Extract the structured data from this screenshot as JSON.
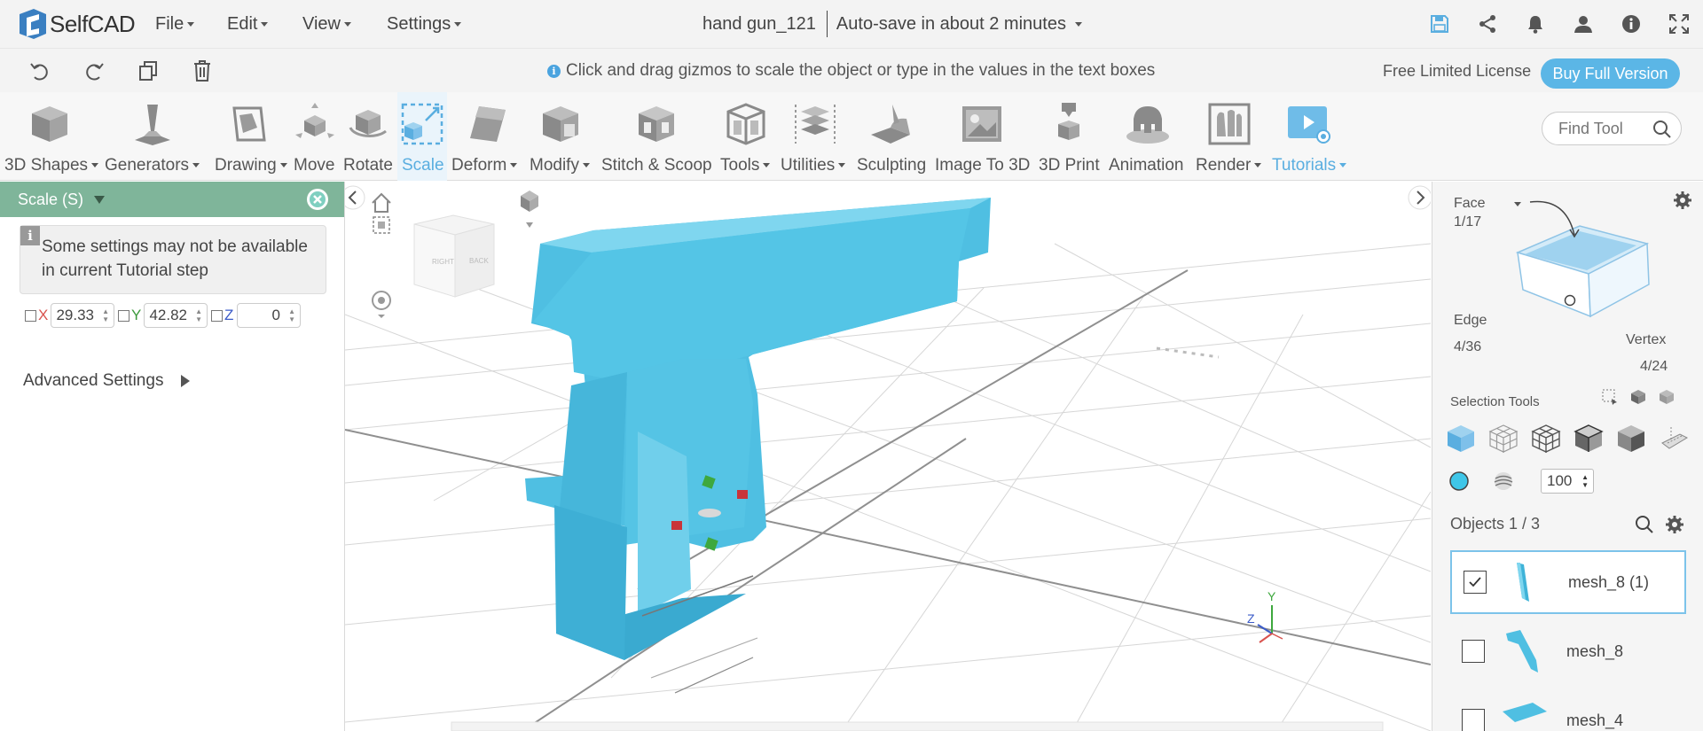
{
  "app": {
    "name": "SelfCAD"
  },
  "menu": [
    {
      "label": "File"
    },
    {
      "label": "Edit"
    },
    {
      "label": "View"
    },
    {
      "label": "Settings"
    }
  ],
  "document": {
    "title": "hand gun_121",
    "autosave": "Auto-save in about 2 minutes"
  },
  "hint": {
    "text": "Click and drag gizmos to scale the object or type in the values in the text boxes"
  },
  "license": {
    "text": "Free Limited License",
    "buy_label": "Buy Full Version"
  },
  "toolbar": {
    "tools": [
      {
        "label": "3D Shapes",
        "dropdown": true
      },
      {
        "label": "Generators",
        "dropdown": true
      },
      {
        "label": "Drawing",
        "dropdown": true
      },
      {
        "label": "Move",
        "dropdown": false
      },
      {
        "label": "Rotate",
        "dropdown": false
      },
      {
        "label": "Scale",
        "dropdown": false
      },
      {
        "label": "Deform",
        "dropdown": true
      },
      {
        "label": "Modify",
        "dropdown": true
      },
      {
        "label": "Stitch & Scoop",
        "dropdown": false
      },
      {
        "label": "Tools",
        "dropdown": true
      },
      {
        "label": "Utilities",
        "dropdown": true
      },
      {
        "label": "Sculpting",
        "dropdown": false
      },
      {
        "label": "Image To 3D",
        "dropdown": false
      },
      {
        "label": "3D Print",
        "dropdown": false
      },
      {
        "label": "Animation",
        "dropdown": false
      },
      {
        "label": "Render",
        "dropdown": true
      },
      {
        "label": "Tutorials",
        "dropdown": true
      }
    ],
    "find_placeholder": "Find Tool"
  },
  "scale_panel": {
    "title": "Scale (S)",
    "note": "Some settings may not be available in current Tutorial step",
    "axes": [
      {
        "label": "X",
        "value": "29.33",
        "color": "#d9534f"
      },
      {
        "label": "Y",
        "value": "42.82",
        "color": "#3c9a3c"
      },
      {
        "label": "Z",
        "value": "0",
        "color": "#3b5bc8"
      }
    ],
    "advanced": "Advanced Settings"
  },
  "viewcube": {
    "face_right": "RIGHT",
    "face_back": "BACK"
  },
  "gizmo": {
    "y": "Y",
    "z": "Z"
  },
  "selection": {
    "face_label": "Face",
    "face_count": "1/17",
    "edge_label": "Edge",
    "edge_count": "4/36",
    "vertex_label": "Vertex",
    "vertex_count": "4/24",
    "tools_label": "Selection Tools",
    "size_value": "100"
  },
  "objects": {
    "header": "Objects 1 / 3",
    "items": [
      {
        "name": "mesh_8 (1)",
        "checked": true
      },
      {
        "name": "mesh_8",
        "checked": false
      },
      {
        "name": "mesh_4",
        "checked": false
      }
    ]
  },
  "colors": {
    "accent": "#5bb6e6",
    "panel_header": "#7fb59a",
    "model": "#5bc8e6"
  }
}
